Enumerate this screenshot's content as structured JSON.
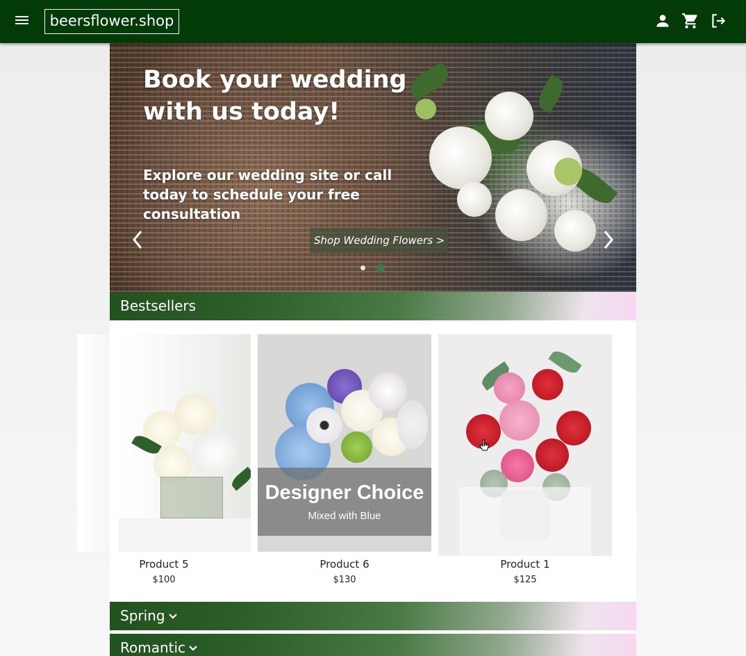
{
  "header": {
    "brand": "beersflower.shop",
    "icons": [
      "menu-icon",
      "account-icon",
      "cart-icon",
      "logout-icon"
    ],
    "background_color": "#023a08"
  },
  "hero": {
    "title": "Book your wedding with us today!",
    "subtitle": "Explore our wedding site or call today to schedule your free consultation",
    "cta_label": "Shop Wedding Flowers >",
    "slide_count": 2,
    "active_slide": 2
  },
  "sections": {
    "bestsellers": "Bestsellers",
    "spring": "Spring",
    "romantic": "Romantic"
  },
  "products": [
    {
      "name": "Product 5",
      "price": "$100"
    },
    {
      "name": "Product 6",
      "price": "$130",
      "overlay_title": "Designer Choice",
      "overlay_subtitle": "Mixed with Blue"
    },
    {
      "name": "Product 1",
      "price": "$125"
    }
  ],
  "colors": {
    "accent_green": "#2c5e29",
    "gradient_end": "#f7d7f1"
  }
}
